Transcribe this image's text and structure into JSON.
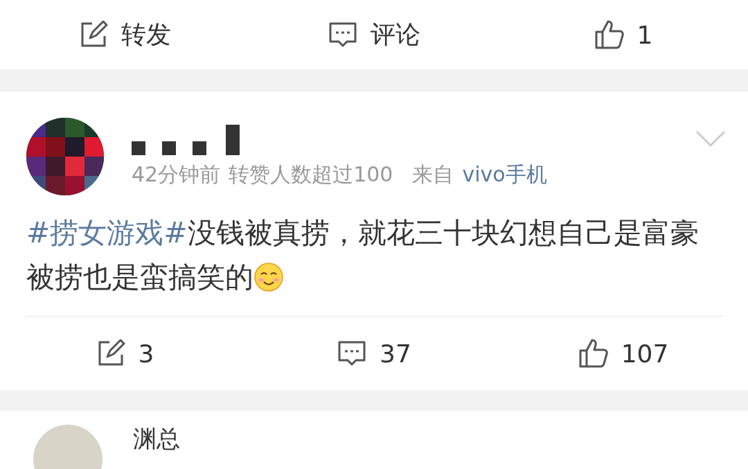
{
  "top_actions": [
    {
      "kind": "repost",
      "label": "转发"
    },
    {
      "kind": "comment",
      "label": "评论"
    },
    {
      "kind": "like",
      "label": "1"
    }
  ],
  "post": {
    "meta": {
      "time": "42分钟前",
      "badge": "转赞人数超过100",
      "source_prefix": "来自",
      "source": "vivo手机"
    },
    "hashtag": "#捞女游戏#",
    "text": "没钱被真捞，就花三十块幻想自己是富豪被捞也是蛮搞笑的",
    "actions": [
      {
        "kind": "repost",
        "label": "3"
      },
      {
        "kind": "comment",
        "label": "37"
      },
      {
        "kind": "like",
        "label": "107"
      }
    ]
  },
  "next_post": {
    "author": "渊总"
  }
}
